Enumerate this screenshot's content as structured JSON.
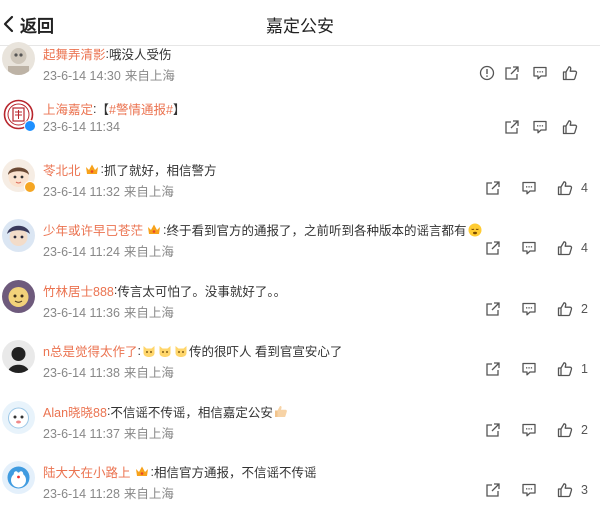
{
  "header": {
    "back_label": "返回",
    "title": "嘉定公安"
  },
  "colors": {
    "username": "#eb7350",
    "meta": "#888888",
    "icon": "#555555",
    "verify_blue": "#1e90ff",
    "vip_gold": "#f5a623"
  },
  "comments": [
    {
      "user": "起舞弄清影",
      "separator": ":",
      "text": "哦没人受伤",
      "time": "23-6-14 14:30",
      "source": "来自上海",
      "likes": ""
    },
    {
      "user": "上海嘉定",
      "separator": ":",
      "text": "【",
      "hashtag": "#警情通报#",
      "text_after": " 】",
      "time": "23-6-14 11:34",
      "source": "",
      "likes": ""
    },
    {
      "user": "苓北北",
      "separator": ":",
      "text": "抓了就好，相信警方",
      "time": "23-6-14 11:32",
      "source": "来自上海",
      "likes": "4"
    },
    {
      "user": "少年或许早已苍茫",
      "separator": ":",
      "text": "终于看到官方的通报了，之前听到各种版本的谣言都有",
      "time": "23-6-14 11:24",
      "source": "来自上海",
      "likes": "4"
    },
    {
      "user": "竹林居士888",
      "separator": ":",
      "text": "传言太可怕了。没事就好了。。",
      "time": "23-6-14 11:36",
      "source": "来自上海",
      "likes": "2"
    },
    {
      "user": "n总是觉得太作了",
      "separator": ":",
      "text": "传的很吓人 看到官宣安心了",
      "time": "23-6-14 11:38",
      "source": "来自上海",
      "likes": "1"
    },
    {
      "user": "Alan晓晓88",
      "separator": ":",
      "text": "不信谣不传谣，相信嘉定公安",
      "time": "23-6-14 11:37",
      "source": "来自上海",
      "likes": "2"
    },
    {
      "user": "陆大大在小路上",
      "separator": ":",
      "text": "相信官方通报，不信谣不传谣",
      "time": "23-6-14 11:28",
      "source": "来自上海",
      "likes": "3"
    }
  ]
}
